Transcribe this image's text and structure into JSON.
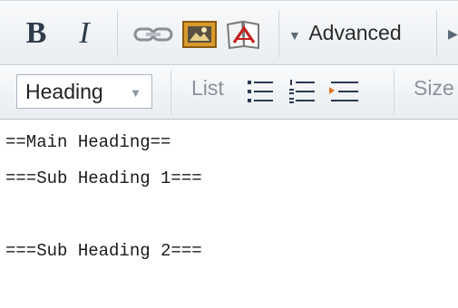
{
  "toolbar": {
    "bold_label": "B",
    "italic_label": "I",
    "icons": [
      "link-icon",
      "image-icon",
      "pdf-icon"
    ],
    "advanced_label": "Advanced",
    "heading_select_value": "Heading",
    "list_label": "List",
    "list_icons": [
      "bulleted-list-icon",
      "numbered-list-icon",
      "indent-list-icon"
    ],
    "size_label": "Size"
  },
  "editor": {
    "lines": [
      "==Main Heading==",
      "===Sub Heading 1===",
      "",
      "===Sub Heading 2==="
    ]
  }
}
